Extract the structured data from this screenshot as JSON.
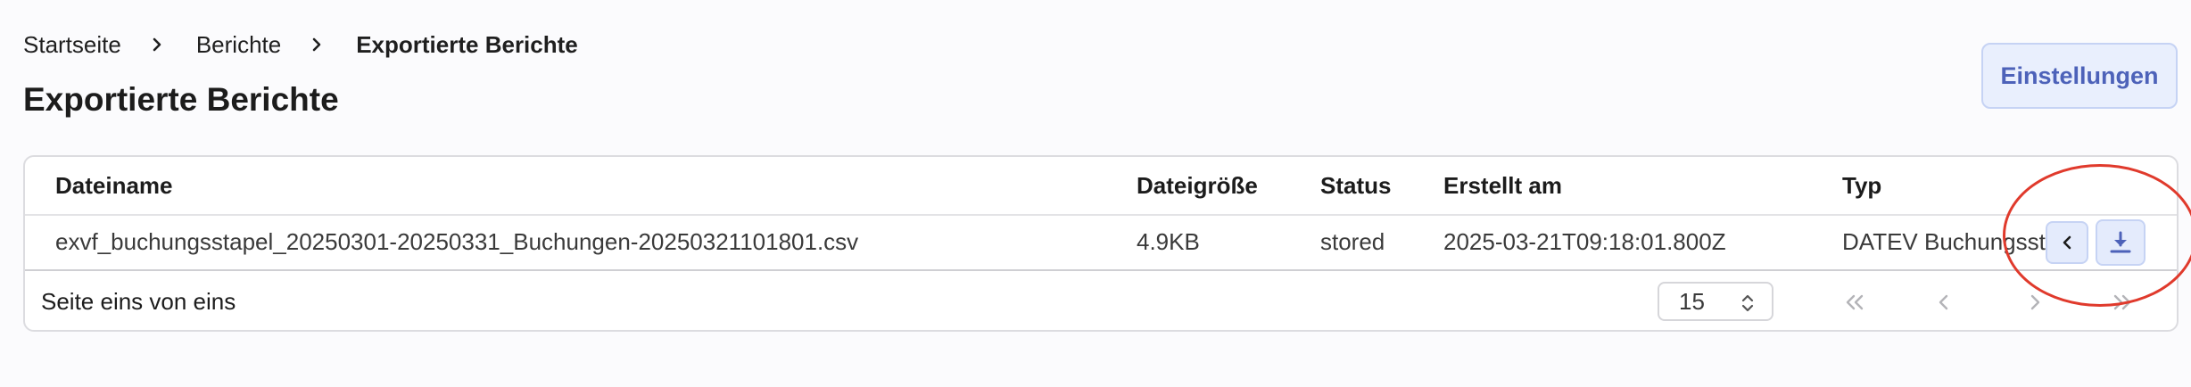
{
  "breadcrumb": {
    "items": [
      {
        "label": "Startseite"
      },
      {
        "label": "Berichte"
      },
      {
        "label": "Exportierte Berichte"
      }
    ]
  },
  "page": {
    "title": "Exportierte Berichte",
    "settings_label": "Einstellungen"
  },
  "table": {
    "columns": {
      "filename": "Dateiname",
      "size": "Dateigröße",
      "status": "Status",
      "created": "Erstellt am",
      "type": "Typ"
    },
    "rows": [
      {
        "filename": "exvf_buchungsstapel_20250301-20250331_Buchungen-20250321101801.csv",
        "size": "4.9KB",
        "status": "stored",
        "created": "2025-03-21T09:18:01.800Z",
        "type": "DATEV Buchungsstapel"
      }
    ]
  },
  "pagination": {
    "info": "Seite eins von eins",
    "page_size": "15"
  },
  "icons": {
    "breadcrumb_separator": "chevron-right-icon",
    "row_prev": "chevron-left-icon",
    "row_download": "download-icon",
    "page_size_arrows": "chevron-up-down-icon",
    "first": "chevrons-left-icon",
    "prev": "chevron-left-icon",
    "next": "chevron-right-icon",
    "last": "chevrons-right-icon"
  },
  "colors": {
    "accent": "#4d62b9",
    "accent_bg": "#e9effd",
    "highlight": "#e03a2c"
  }
}
